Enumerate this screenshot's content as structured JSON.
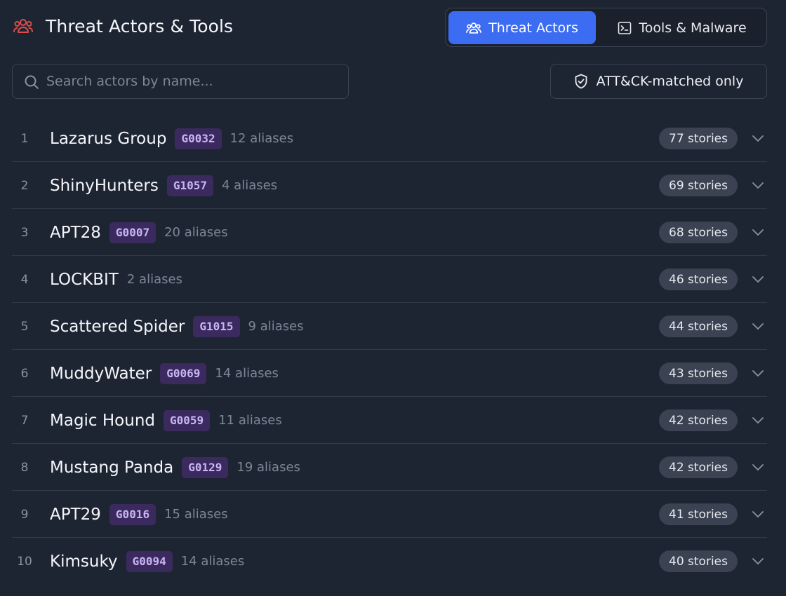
{
  "header": {
    "title": "Threat Actors & Tools",
    "title_icon": "users-icon",
    "accent": "#e04a4a"
  },
  "tabs": [
    {
      "label": "Threat Actors",
      "icon": "users-icon",
      "active": true
    },
    {
      "label": "Tools & Malware",
      "icon": "terminal-icon",
      "active": false
    }
  ],
  "search": {
    "placeholder": "Search actors by name...",
    "value": ""
  },
  "filter": {
    "label": "ATT&CK-matched only",
    "icon": "shield-check-icon"
  },
  "actors": [
    {
      "rank": "1",
      "name": "Lazarus Group",
      "group_id": "G0032",
      "aliases": "12 aliases",
      "stories": "77 stories"
    },
    {
      "rank": "2",
      "name": "ShinyHunters",
      "group_id": "G1057",
      "aliases": "4 aliases",
      "stories": "69 stories"
    },
    {
      "rank": "3",
      "name": "APT28",
      "group_id": "G0007",
      "aliases": "20 aliases",
      "stories": "68 stories"
    },
    {
      "rank": "4",
      "name": "LOCKBIT",
      "group_id": "",
      "aliases": "2 aliases",
      "stories": "46 stories"
    },
    {
      "rank": "5",
      "name": "Scattered Spider",
      "group_id": "G1015",
      "aliases": "9 aliases",
      "stories": "44 stories"
    },
    {
      "rank": "6",
      "name": "MuddyWater",
      "group_id": "G0069",
      "aliases": "14 aliases",
      "stories": "43 stories"
    },
    {
      "rank": "7",
      "name": "Magic Hound",
      "group_id": "G0059",
      "aliases": "11 aliases",
      "stories": "42 stories"
    },
    {
      "rank": "8",
      "name": "Mustang Panda",
      "group_id": "G0129",
      "aliases": "19 aliases",
      "stories": "42 stories"
    },
    {
      "rank": "9",
      "name": "APT29",
      "group_id": "G0016",
      "aliases": "15 aliases",
      "stories": "41 stories"
    },
    {
      "rank": "10",
      "name": "Kimsuky",
      "group_id": "G0094",
      "aliases": "14 aliases",
      "stories": "40 stories"
    }
  ],
  "colors": {
    "background": "#1e2532",
    "active_tab": "#3b6cf2",
    "badge_bg": "#3b2a5e",
    "badge_text": "#c9b3f5",
    "pill_bg": "#3b4352"
  }
}
